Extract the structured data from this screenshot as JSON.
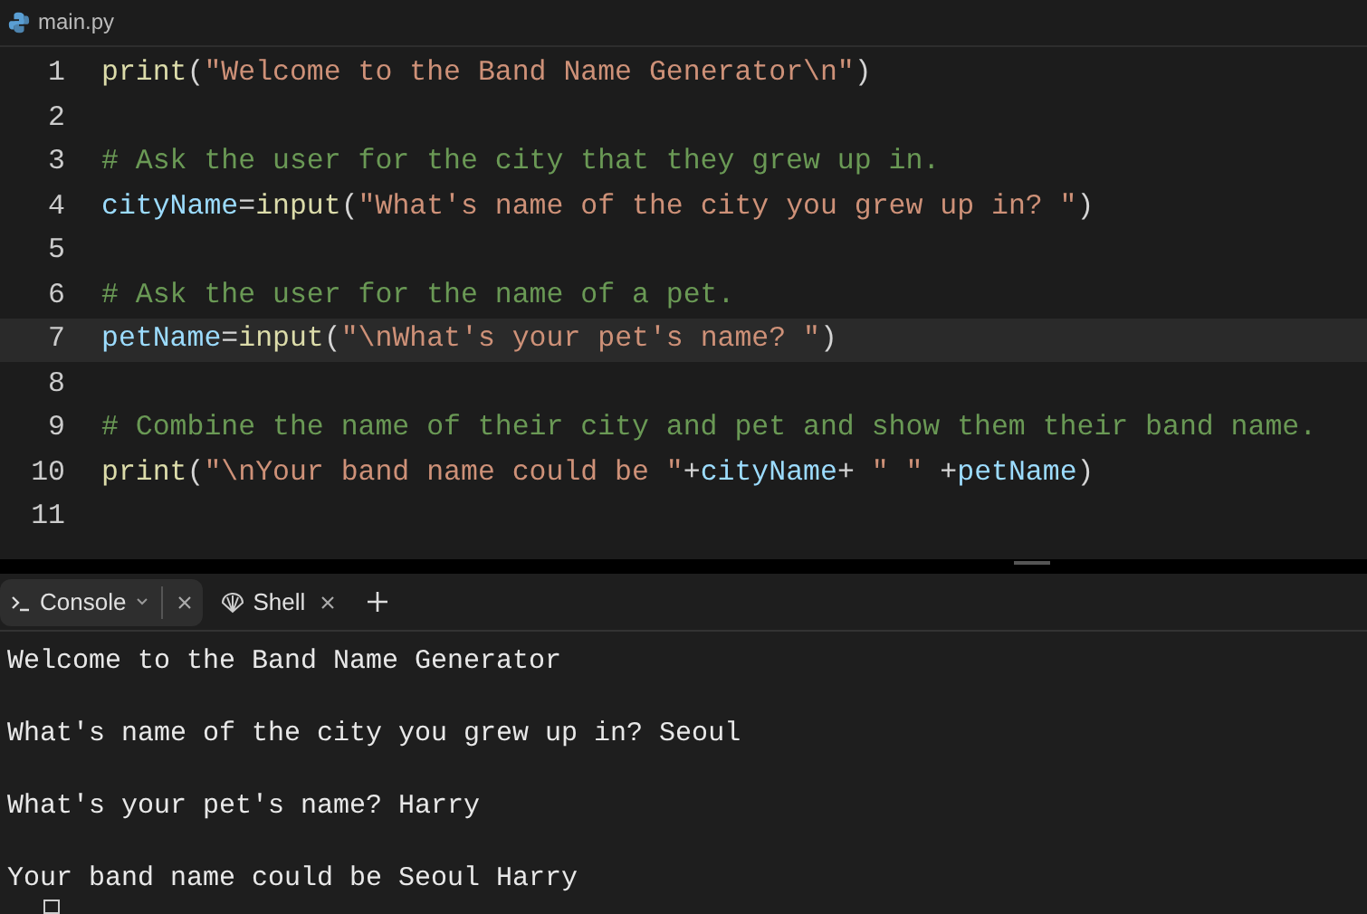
{
  "file_tab": {
    "label": "main.py"
  },
  "code_lines": [
    {
      "number": "1",
      "current": false,
      "tokens": [
        {
          "text": "print",
          "kind": "func"
        },
        {
          "text": "(",
          "kind": "punct"
        },
        {
          "text": "\"Welcome to the Band Name Generator\\n\"",
          "kind": "string"
        },
        {
          "text": ")",
          "kind": "punct"
        }
      ]
    },
    {
      "number": "2",
      "current": false
    },
    {
      "number": "3",
      "current": false,
      "tokens": [
        {
          "text": "# Ask the user for the city that they grew up in.",
          "kind": "comment"
        }
      ]
    },
    {
      "number": "4",
      "current": false,
      "tokens": [
        {
          "text": "cityName",
          "kind": "variable"
        },
        {
          "text": "=",
          "kind": "punct"
        },
        {
          "text": "input",
          "kind": "func"
        },
        {
          "text": "(",
          "kind": "punct"
        },
        {
          "text": "\"What's name of the city you grew up in? \"",
          "kind": "string"
        },
        {
          "text": ")",
          "kind": "punct"
        }
      ]
    },
    {
      "number": "5",
      "current": false
    },
    {
      "number": "6",
      "current": false,
      "tokens": [
        {
          "text": "# Ask the user for the name of a pet.",
          "kind": "comment"
        }
      ]
    },
    {
      "number": "7",
      "current": true,
      "tokens": [
        {
          "text": "petName",
          "kind": "variable"
        },
        {
          "text": "=",
          "kind": "punct"
        },
        {
          "text": "input",
          "kind": "func"
        },
        {
          "text": "(",
          "kind": "punct"
        },
        {
          "text": "\"\\nWhat's your pet's name? \"",
          "kind": "string"
        },
        {
          "text": ")",
          "kind": "punct"
        }
      ]
    },
    {
      "number": "8",
      "current": false
    },
    {
      "number": "9",
      "current": false,
      "tokens": [
        {
          "text": "# Combine the name of their city and pet and show them their band name.",
          "kind": "comment"
        }
      ]
    },
    {
      "number": "10",
      "current": false,
      "tokens": [
        {
          "text": "print",
          "kind": "func"
        },
        {
          "text": "(",
          "kind": "punct"
        },
        {
          "text": "\"\\nYour band name could be \"",
          "kind": "string"
        },
        {
          "text": "+",
          "kind": "punct"
        },
        {
          "text": "cityName",
          "kind": "variable"
        },
        {
          "text": "+ ",
          "kind": "punct"
        },
        {
          "text": "\" \"",
          "kind": "string"
        },
        {
          "text": " +",
          "kind": "punct"
        },
        {
          "text": "petName",
          "kind": "variable"
        },
        {
          "text": ")",
          "kind": "punct"
        }
      ]
    },
    {
      "number": "11",
      "current": false
    }
  ],
  "panel_tabs": [
    {
      "label": "Console",
      "selected": true,
      "kind": "console"
    },
    {
      "label": "Shell",
      "selected": false,
      "kind": "shell"
    }
  ],
  "console_output": [
    "Welcome to the Band Name Generator",
    "What's name of the city you grew up in? Seoul",
    "What's your pet's name? Harry",
    "Your band name could be Seoul Harry"
  ]
}
